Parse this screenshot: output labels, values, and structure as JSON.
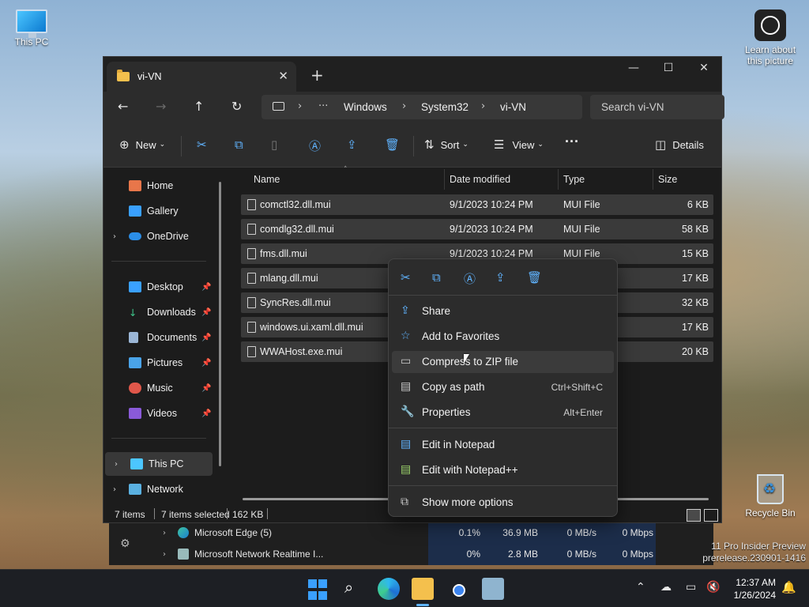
{
  "desktop": {
    "this_pc": "This PC",
    "learn": "Learn about this picture",
    "recycle_bin": "Recycle Bin",
    "watermark_line1": "11 Pro Insider Preview",
    "watermark_line2": "prerelease.230901-1416"
  },
  "explorer": {
    "tab_title": "vi-VN",
    "breadcrumb": [
      "Windows",
      "System32",
      "vi-VN"
    ],
    "search_placeholder": "Search vi-VN",
    "commands": {
      "new": "New",
      "sort": "Sort",
      "view": "View",
      "details": "Details"
    },
    "nav": {
      "home": "Home",
      "gallery": "Gallery",
      "onedrive": "OneDrive",
      "desktop": "Desktop",
      "downloads": "Downloads",
      "documents": "Documents",
      "pictures": "Pictures",
      "music": "Music",
      "videos": "Videos",
      "this_pc": "This PC",
      "network": "Network"
    },
    "columns": {
      "name": "Name",
      "date": "Date modified",
      "type": "Type",
      "size": "Size"
    },
    "files": [
      {
        "name": "comctl32.dll.mui",
        "date": "9/1/2023 10:24 PM",
        "type": "MUI File",
        "size": "6 KB"
      },
      {
        "name": "comdlg32.dll.mui",
        "date": "9/1/2023 10:24 PM",
        "type": "MUI File",
        "size": "58 KB"
      },
      {
        "name": "fms.dll.mui",
        "date": "9/1/2023 10:24 PM",
        "type": "MUI File",
        "size": "15 KB"
      },
      {
        "name": "mlang.dll.mui",
        "date": "",
        "type": "",
        "size": "17 KB"
      },
      {
        "name": "SyncRes.dll.mui",
        "date": "",
        "type": "",
        "size": "32 KB"
      },
      {
        "name": "windows.ui.xaml.dll.mui",
        "date": "",
        "type": "",
        "size": "17 KB"
      },
      {
        "name": "WWAHost.exe.mui",
        "date": "",
        "type": "",
        "size": "20 KB"
      }
    ],
    "status": {
      "items": "7 items",
      "selected": "7 items selected",
      "size": "162 KB"
    }
  },
  "context_menu": {
    "share": "Share",
    "favorites": "Add to Favorites",
    "compress": "Compress to ZIP file",
    "copy_path": "Copy as path",
    "copy_path_key": "Ctrl+Shift+C",
    "properties": "Properties",
    "properties_key": "Alt+Enter",
    "notepad": "Edit in Notepad",
    "notepadpp": "Edit with Notepad++",
    "more": "Show more options"
  },
  "task_manager": {
    "rows": [
      {
        "name": "Microsoft Edge (5)",
        "cpu": "0.1%",
        "mem": "36.9 MB",
        "disk": "0 MB/s",
        "net": "0 Mbps"
      },
      {
        "name": "Microsoft Network Realtime I...",
        "cpu": "0%",
        "mem": "2.8 MB",
        "disk": "0 MB/s",
        "net": "0 Mbps"
      }
    ]
  },
  "taskbar": {
    "time": "12:37 AM",
    "date": "1/26/2024"
  },
  "colors": {
    "accent": "#60b4ff",
    "folder": "#f4c04d"
  }
}
